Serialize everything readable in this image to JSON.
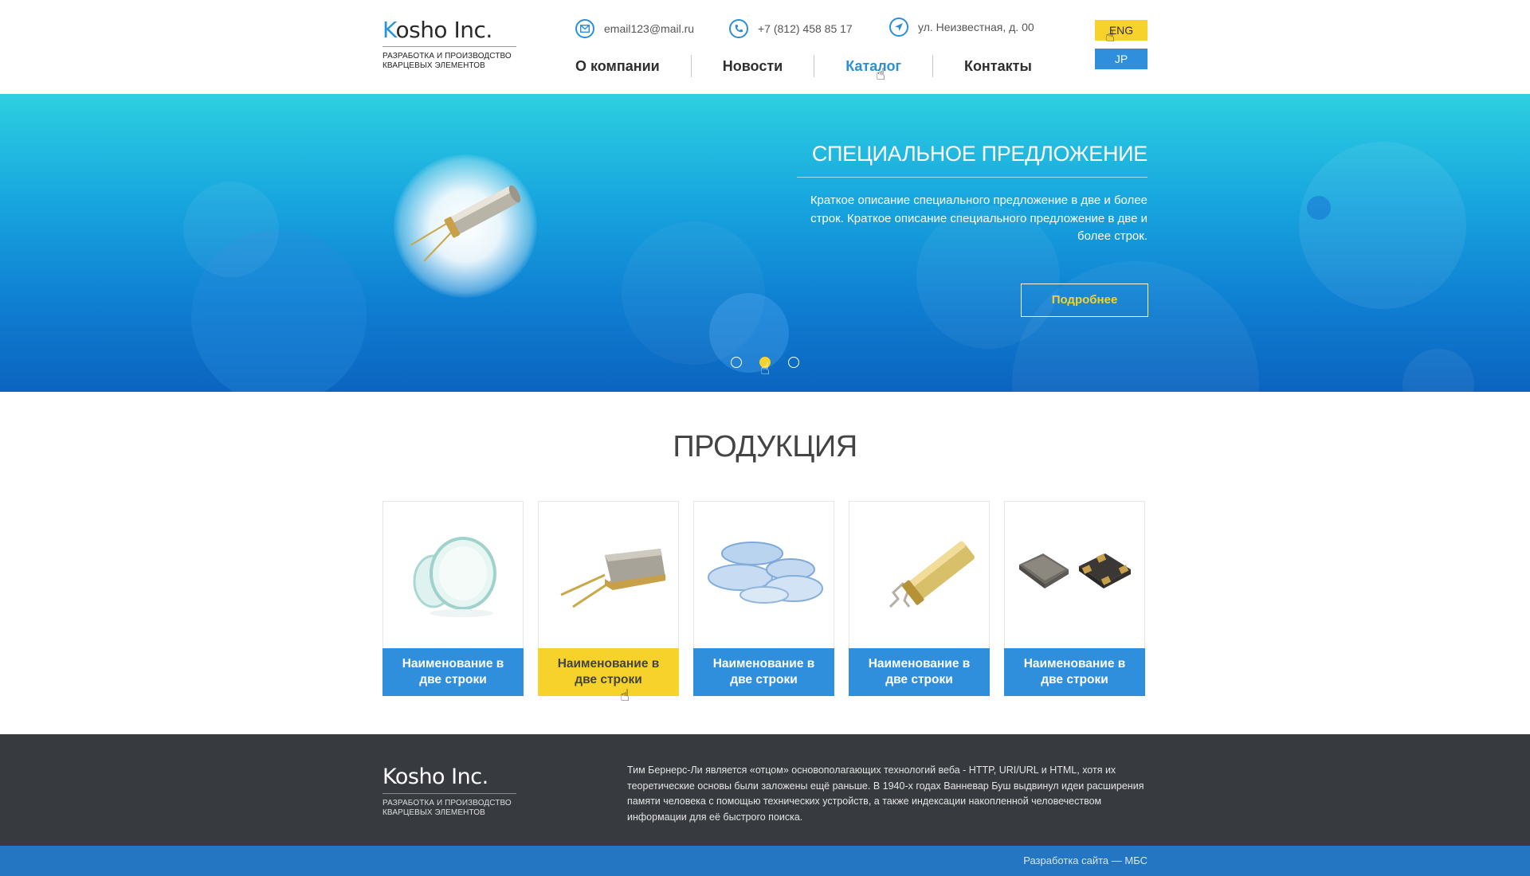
{
  "header": {
    "logo": {
      "first_letter": "K",
      "rest": "osho Inc.",
      "subtitle_line1": "РАЗРАБОТКА И ПРОИЗВОДСТВО",
      "subtitle_line2": "КВАРЦЕВЫХ ЭЛЕМЕНТОВ"
    },
    "email": "email123@mail.ru",
    "phone": "+7 (812) 458 85 17",
    "address": "ул. Неизвестная, д. 00",
    "nav": [
      "О компании",
      "Новости",
      "Каталог",
      "Контакты"
    ],
    "nav_active": "Каталог",
    "languages": [
      "ENG",
      "JP"
    ]
  },
  "hero": {
    "title": "СПЕЦИАЛЬНОЕ ПРЕДЛОЖЕНИЕ",
    "description": "Краткое описание специального предложение в две и более строк. Краткое описание специального предложение в две и более строк.",
    "button": "Подробнее",
    "slides_total": 3,
    "active_slide": 2
  },
  "products": {
    "title": "ПРОДУКЦИЯ",
    "items": [
      {
        "label": "Наименование в две строки",
        "icon": "crystal-lens-icon"
      },
      {
        "label": "Наименование в две строки",
        "icon": "hc49-crystal-icon"
      },
      {
        "label": "Наименование в две строки",
        "icon": "quartz-discs-icon"
      },
      {
        "label": "Наименование в две строки",
        "icon": "gold-cylinder-crystal-icon"
      },
      {
        "label": "Наименование в две строки",
        "icon": "smd-crystal-icon"
      }
    ],
    "highlighted_index": 1
  },
  "footer": {
    "logo": {
      "text": "Kosho Inc.",
      "subtitle_line1": "РАЗРАБОТКА И ПРОИЗВОДСТВО",
      "subtitle_line2": "КВАРЦЕВЫХ ЭЛЕМЕНТОВ"
    },
    "text": "Тим Бернерс-Ли является «отцом» основополагающих технологий веба - HTTP, URI/URL и HTML, хотя их теоретические основы были заложены ещё раньше. В 1940-х годах Ванневар Буш выдвинул идеи расширения памяти человека с помощью технических устройств, а также индексации накопленной человечеством информации для её быстрого поиска.",
    "credit": "Разработка сайта — МБС"
  },
  "colors": {
    "accent_blue": "#2f8fdc",
    "accent_yellow": "#f6d22b",
    "footer_dark": "#373b3f",
    "bottom_bar": "#2476c2"
  }
}
